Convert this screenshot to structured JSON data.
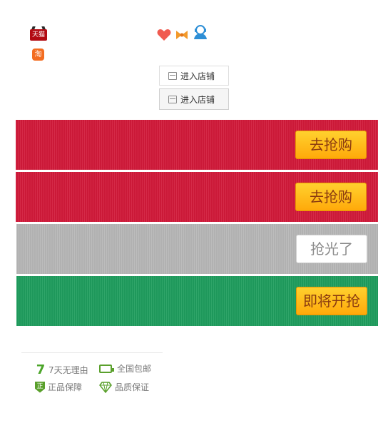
{
  "platform_icons": {
    "tmall": "天猫",
    "taobao": "淘"
  },
  "top_icons": [
    "heart-icon",
    "bow-icon",
    "customer-service-icon"
  ],
  "store_buttons": [
    {
      "label": "进入店铺"
    },
    {
      "label": "进入店铺"
    }
  ],
  "banners": [
    {
      "color": "#d21a3a",
      "cta": "去抢购",
      "state": "available"
    },
    {
      "color": "#d21a3a",
      "cta": "去抢购",
      "state": "available"
    },
    {
      "color": "#b7b7b7",
      "cta": "抢光了",
      "state": "sold-out"
    },
    {
      "color": "#1f9e5e",
      "cta": "即将开抢",
      "state": "upcoming"
    }
  ],
  "guarantees": {
    "seven_day": {
      "icon": "7",
      "label": "7天无理由"
    },
    "free_shipping": {
      "label": "全国包邮"
    },
    "authentic": {
      "icon": "正",
      "label": "正品保障"
    },
    "quality": {
      "label": "品质保证"
    }
  },
  "colors": {
    "accent_red": "#d21a3a",
    "button_yellow": "#ffb81c",
    "upcoming_green": "#1f9e5e",
    "guarantee_green": "#5aa02c"
  }
}
